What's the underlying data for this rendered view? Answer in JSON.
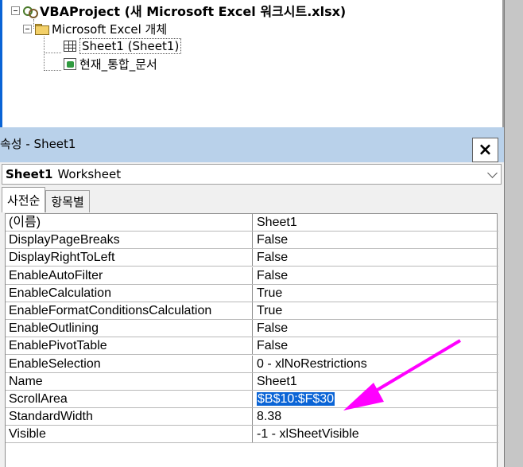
{
  "project_tree": {
    "project_label": "VBAProject (새 Microsoft Excel 워크시트.xlsx)",
    "folder_label": "Microsoft Excel 개체",
    "items": [
      {
        "label": "Sheet1 (Sheet1)",
        "icon": "worksheet-icon"
      },
      {
        "label": "현재_통합_문서",
        "icon": "workbook-icon"
      }
    ]
  },
  "properties": {
    "title": "속성 - Sheet1",
    "close_label": "×",
    "object_name": "Sheet1",
    "object_type": "Worksheet",
    "tabs": [
      "사전순",
      "항목별"
    ],
    "active_tab": "사전순",
    "rows": [
      {
        "name": "(이름)",
        "value": "Sheet1"
      },
      {
        "name": "DisplayPageBreaks",
        "value": "False"
      },
      {
        "name": "DisplayRightToLeft",
        "value": "False"
      },
      {
        "name": "EnableAutoFilter",
        "value": "False"
      },
      {
        "name": "EnableCalculation",
        "value": "True"
      },
      {
        "name": "EnableFormatConditionsCalculation",
        "value": "True"
      },
      {
        "name": "EnableOutlining",
        "value": "False"
      },
      {
        "name": "EnablePivotTable",
        "value": "False"
      },
      {
        "name": "EnableSelection",
        "value": "0 - xlNoRestrictions"
      },
      {
        "name": "Name",
        "value": "Sheet1"
      },
      {
        "name": "ScrollArea",
        "value": "$B$10:$F$30"
      },
      {
        "name": "StandardWidth",
        "value": "8.38"
      },
      {
        "name": "Visible",
        "value": "-1 - xlSheetVisible"
      }
    ],
    "selected_row": "ScrollArea"
  },
  "colors": {
    "title_bar": "#b9d1ea",
    "selection": "#0a64d6",
    "annotation_arrow": "#ff00ff"
  }
}
